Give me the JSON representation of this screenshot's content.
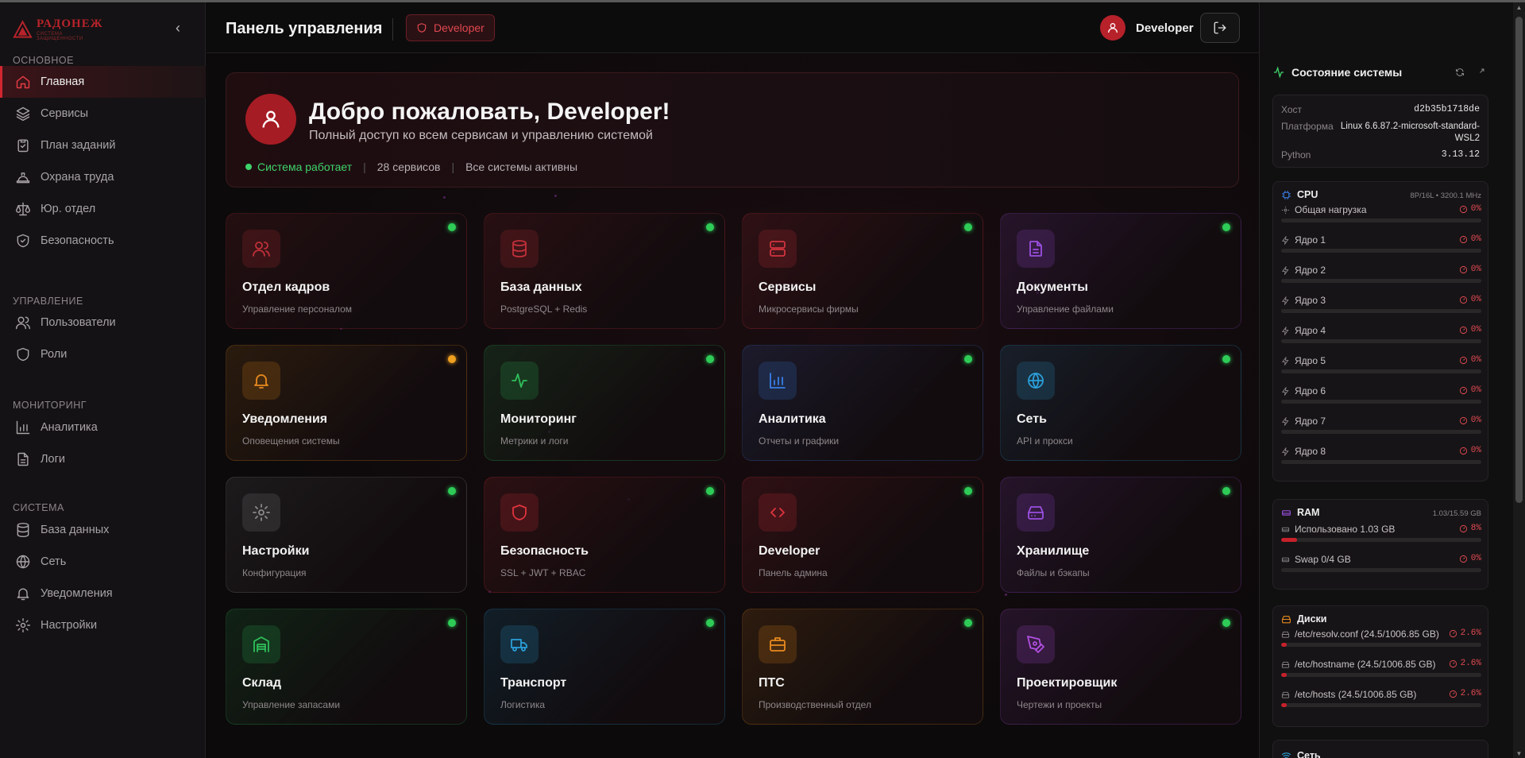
{
  "brand": {
    "name": "РАДОНЕЖ",
    "tagline": "СИСТЕМА ЗАЩИЩЕННОСТИ"
  },
  "sidebar": {
    "sections": [
      {
        "title": "ОСНОВНОЕ",
        "items": [
          "Главная",
          "Сервисы",
          "План заданий",
          "Охрана труда",
          "Юр. отдел",
          "Безопасность"
        ]
      },
      {
        "title": "УПРАВЛЕНИЕ",
        "items": [
          "Пользователи",
          "Роли"
        ]
      },
      {
        "title": "МОНИТОРИНГ",
        "items": [
          "Аналитика",
          "Логи"
        ]
      },
      {
        "title": "СИСТЕМА",
        "items": [
          "База данных",
          "Сеть",
          "Уведомления",
          "Настройки"
        ]
      }
    ],
    "active_item": "Главная"
  },
  "header": {
    "title": "Панель управления",
    "role_badge": "Developer",
    "user_name": "Developer"
  },
  "welcome": {
    "title": "Добро пожаловать, Developer!",
    "subtitle": "Полный доступ ко всем сервисам и управлению системой",
    "status": "Система работает",
    "services_count": "28 сервисов",
    "all_active": "Все системы активны"
  },
  "cards": [
    {
      "title": "Отдел кадров",
      "subtitle": "Управление персоналом",
      "icon": "users-icon",
      "color": "#c0303a",
      "status": "online"
    },
    {
      "title": "База данных",
      "subtitle": "PostgreSQL + Redis",
      "icon": "database-icon",
      "color": "#c0303a",
      "status": "online"
    },
    {
      "title": "Сервисы",
      "subtitle": "Микросервисы фирмы",
      "icon": "server-icon",
      "color": "#d2343e",
      "status": "online"
    },
    {
      "title": "Документы",
      "subtitle": "Управление файлами",
      "icon": "document-icon",
      "color": "#9b4fe0",
      "status": "online"
    },
    {
      "title": "Уведомления",
      "subtitle": "Оповещения системы",
      "icon": "bell-icon",
      "color": "#e98a1e",
      "status": "warning"
    },
    {
      "title": "Мониторинг",
      "subtitle": "Метрики и логи",
      "icon": "activity-icon",
      "color": "#2fbf5a",
      "status": "online"
    },
    {
      "title": "Аналитика",
      "subtitle": "Отчеты и графики",
      "icon": "bar-chart-icon",
      "color": "#3a7ee6",
      "status": "online"
    },
    {
      "title": "Сеть",
      "subtitle": "API и прокси",
      "icon": "globe-icon",
      "color": "#2b9fd9",
      "status": "online"
    },
    {
      "title": "Настройки",
      "subtitle": "Конфигурация",
      "icon": "gear-icon",
      "color": "#8a8a8a",
      "status": "online"
    },
    {
      "title": "Безопасность",
      "subtitle": "SSL + JWT + RBAC",
      "icon": "shield-icon",
      "color": "#e0343e",
      "status": "online"
    },
    {
      "title": "Developer",
      "subtitle": "Панель админа",
      "icon": "code-icon",
      "color": "#e0343e",
      "status": "online"
    },
    {
      "title": "Хранилище",
      "subtitle": "Файлы и бэкапы",
      "icon": "hard-drive-icon",
      "color": "#9b4fe0",
      "status": "online"
    },
    {
      "title": "Склад",
      "subtitle": "Управление запасами",
      "icon": "warehouse-icon",
      "color": "#2fbf5a",
      "status": "online"
    },
    {
      "title": "Транспорт",
      "subtitle": "Логистика",
      "icon": "truck-icon",
      "color": "#2b9fd9",
      "status": "online"
    },
    {
      "title": "ПТС",
      "subtitle": "Производственный отдел",
      "icon": "briefcase-icon",
      "color": "#e98a1e",
      "status": "online"
    },
    {
      "title": "Проектировщик",
      "subtitle": "Чертежи и проекты",
      "icon": "pen-tool-icon",
      "color": "#b04fe0",
      "status": "online"
    }
  ],
  "system": {
    "title": "Состояние системы",
    "info": [
      {
        "k": "Хост",
        "v": "d2b35b1718de"
      },
      {
        "k": "Платформа",
        "v": "Linux 6.6.87.2-microsoft-standard-WSL2"
      },
      {
        "k": "Python",
        "v": "3.13.12"
      }
    ],
    "cpu": {
      "title": "CPU",
      "spec": "8P/16L • 3200.1 MHz",
      "rows": [
        {
          "label": "Общая нагрузка",
          "value": "0%",
          "fraction": 0
        },
        {
          "label": "Ядро 1",
          "value": "0%",
          "fraction": 0
        },
        {
          "label": "Ядро 2",
          "value": "0%",
          "fraction": 0
        },
        {
          "label": "Ядро 3",
          "value": "0%",
          "fraction": 0
        },
        {
          "label": "Ядро 4",
          "value": "0%",
          "fraction": 0
        },
        {
          "label": "Ядро 5",
          "value": "0%",
          "fraction": 0
        },
        {
          "label": "Ядро 6",
          "value": "0%",
          "fraction": 0
        },
        {
          "label": "Ядро 7",
          "value": "0%",
          "fraction": 0
        },
        {
          "label": "Ядро 8",
          "value": "0%",
          "fraction": 0
        }
      ]
    },
    "ram": {
      "title": "RAM",
      "spec": "1.03/15.59 GB",
      "rows": [
        {
          "label": "Использовано 1.03 GB",
          "value": "8%",
          "fraction": 0.08
        },
        {
          "label": "Swap 0/4 GB",
          "value": "0%",
          "fraction": 0
        }
      ]
    },
    "disks": {
      "title": "Диски",
      "rows": [
        {
          "label": "/etc/resolv.conf (24.5/1006.85 GB)",
          "value": "2.6%",
          "fraction": 0.026
        },
        {
          "label": "/etc/hostname (24.5/1006.85 GB)",
          "value": "2.6%",
          "fraction": 0.026
        },
        {
          "label": "/etc/hosts (24.5/1006.85 GB)",
          "value": "2.6%",
          "fraction": 0.026
        }
      ]
    },
    "network": {
      "title": "Сеть"
    }
  }
}
